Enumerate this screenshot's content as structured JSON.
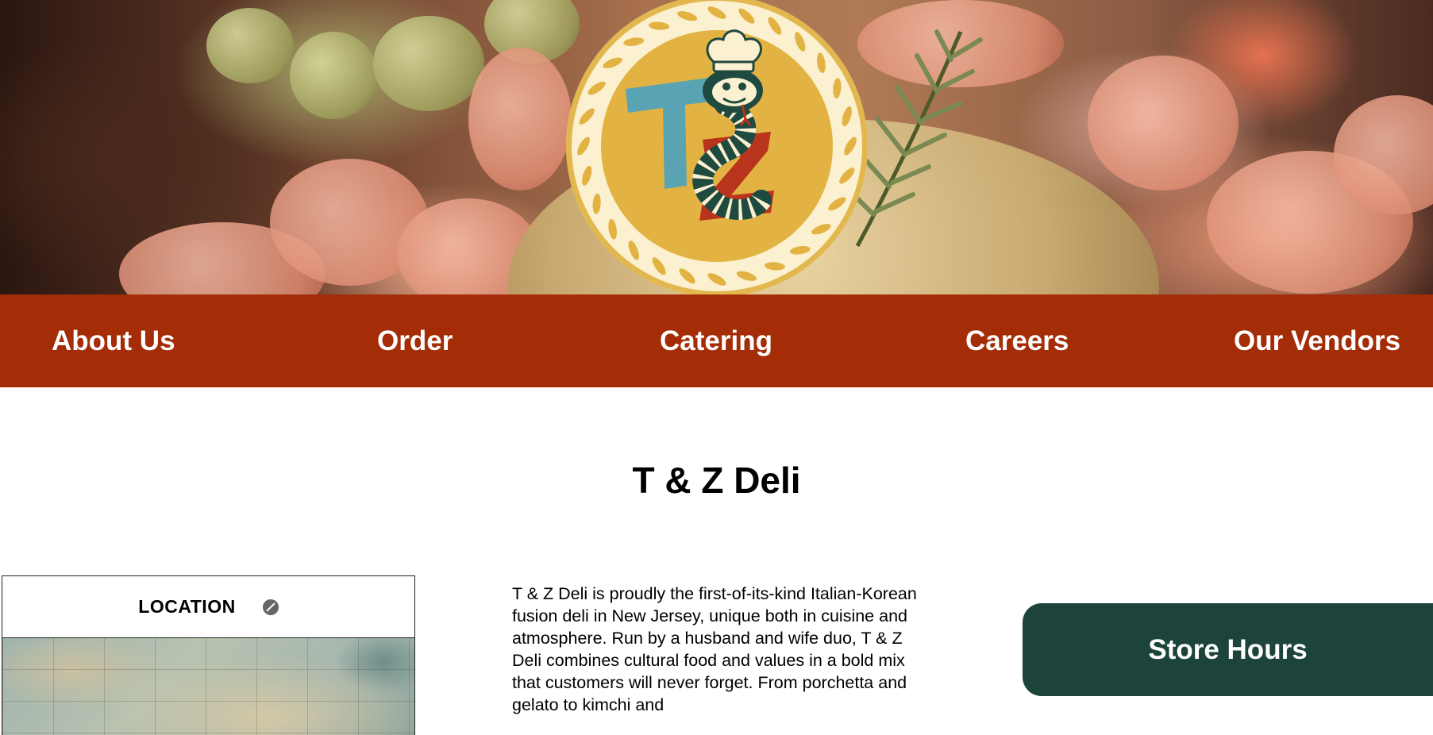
{
  "hero": {
    "logo_icon": "t-z-deli-chef-snake-logo",
    "logo_letters": "T Z"
  },
  "nav": {
    "items": [
      {
        "label": "About Us"
      },
      {
        "label": "Order"
      },
      {
        "label": "Catering"
      },
      {
        "label": "Careers"
      },
      {
        "label": "Our Vendors"
      }
    ]
  },
  "main": {
    "title": "T & Z Deli",
    "about_text": "T & Z Deli is proudly the first-of-its-kind Italian-Korean fusion deli in New Jersey, unique both in cuisine and atmosphere. Run by a husband and wife duo, T & Z Deli combines cultural food and values in a bold mix that customers will never forget. From porchetta and gelato to kimchi and"
  },
  "location": {
    "label": "LOCATION",
    "icon": "compass-icon"
  },
  "hours": {
    "label": "Store Hours"
  },
  "colors": {
    "nav_bg": "#a42c07",
    "hours_bg": "#1d443a",
    "logo_gold": "#e2b342",
    "logo_teal": "#5aa3b2",
    "logo_red": "#b9341c"
  }
}
